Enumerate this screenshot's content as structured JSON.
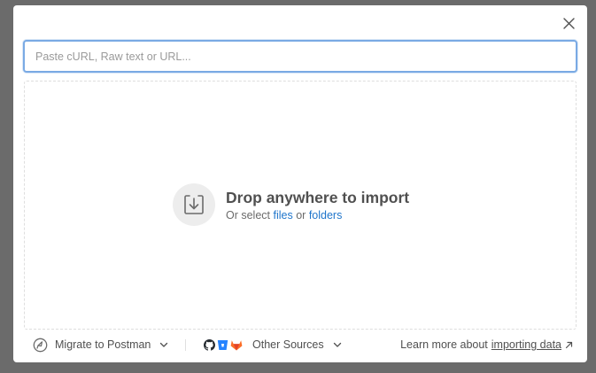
{
  "dialog": {
    "close_icon": "close-icon"
  },
  "search": {
    "placeholder": "Paste cURL, Raw text or URL...",
    "value": ""
  },
  "dropzone": {
    "icon": "import-tray-icon",
    "title": "Drop anywhere to import",
    "prefix": "Or select",
    "files_link": "files",
    "connector": "or",
    "folders_link": "folders"
  },
  "footer": {
    "migrate_label": "Migrate to Postman",
    "other_sources_label": "Other Sources",
    "learn_prefix": "Learn more about",
    "learn_link": "importing data",
    "source_icons": [
      "github-icon",
      "bitbucket-icon",
      "gitlab-icon"
    ]
  },
  "colors": {
    "accent": "#1f75cb",
    "focus_border": "#7aaae4",
    "overlay": "#6b6b6b"
  }
}
